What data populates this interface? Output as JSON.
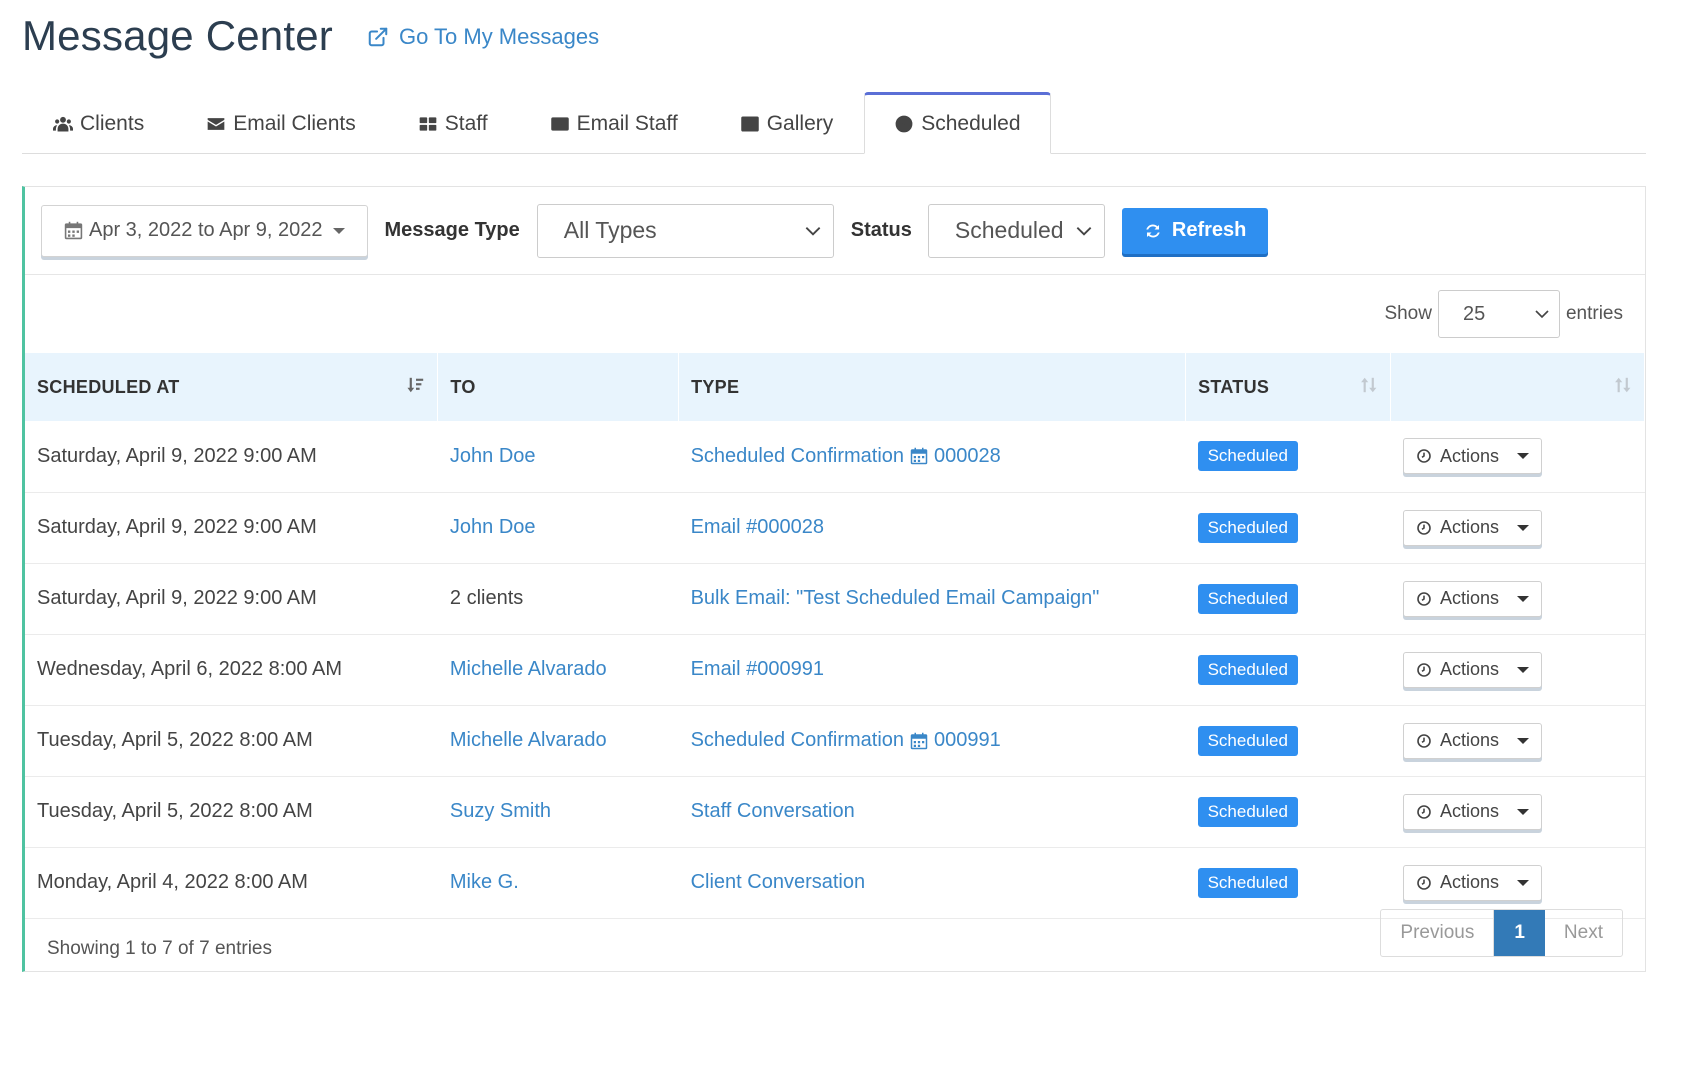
{
  "header": {
    "title": "Message Center",
    "go_link": "Go To My Messages"
  },
  "tabs": [
    {
      "label": "Clients",
      "icon": "users-icon"
    },
    {
      "label": "Email Clients",
      "icon": "envelope-icon"
    },
    {
      "label": "Staff",
      "icon": "grid-icon"
    },
    {
      "label": "Email Staff",
      "icon": "envelope-outline-icon"
    },
    {
      "label": "Gallery",
      "icon": "image-icon"
    },
    {
      "label": "Scheduled",
      "icon": "clock-icon",
      "active": true
    }
  ],
  "filters": {
    "date_range": "Apr 3, 2022 to Apr 9, 2022",
    "message_type_label": "Message Type",
    "message_type_value": "All Types",
    "status_label": "Status",
    "status_value": "Scheduled",
    "refresh_label": "Refresh"
  },
  "show": {
    "prefix": "Show",
    "value": "25",
    "suffix": "entries"
  },
  "table": {
    "columns": [
      "SCHEDULED AT",
      "TO",
      "TYPE",
      "STATUS",
      ""
    ],
    "rows": [
      {
        "scheduled_at": "Saturday, April 9, 2022 9:00 AM",
        "to": "John Doe",
        "to_link": true,
        "type": "Scheduled Confirmation",
        "type_ref": "000028",
        "status": "Scheduled",
        "actions": "Actions"
      },
      {
        "scheduled_at": "Saturday, April 9, 2022 9:00 AM",
        "to": "John Doe",
        "to_link": true,
        "type": "Email  #000028",
        "type_ref": "",
        "status": "Scheduled",
        "actions": "Actions"
      },
      {
        "scheduled_at": "Saturday, April 9, 2022 9:00 AM",
        "to": "2 clients",
        "to_link": false,
        "type": "Bulk Email: \"Test Scheduled Email Campaign\"",
        "type_ref": "",
        "status": "Scheduled",
        "actions": "Actions"
      },
      {
        "scheduled_at": "Wednesday, April 6, 2022 8:00 AM",
        "to": "Michelle Alvarado",
        "to_link": true,
        "type": "Email  #000991",
        "type_ref": "",
        "status": "Scheduled",
        "actions": "Actions"
      },
      {
        "scheduled_at": "Tuesday, April 5, 2022 8:00 AM",
        "to": "Michelle Alvarado",
        "to_link": true,
        "type": "Scheduled Confirmation",
        "type_ref": "000991",
        "status": "Scheduled",
        "actions": "Actions"
      },
      {
        "scheduled_at": "Tuesday, April 5, 2022 8:00 AM",
        "to": "Suzy Smith",
        "to_link": true,
        "type": "Staff Conversation",
        "type_ref": "",
        "status": "Scheduled",
        "actions": "Actions"
      },
      {
        "scheduled_at": "Monday, April 4, 2022 8:00 AM",
        "to": "Mike G.",
        "to_link": true,
        "type": "Client Conversation",
        "type_ref": "",
        "status": "Scheduled",
        "actions": "Actions"
      }
    ]
  },
  "footer": {
    "info": "Showing 1 to 7 of 7 entries",
    "prev": "Previous",
    "current": "1",
    "next": "Next"
  },
  "colors": {
    "accent_blue": "#2f8ff0",
    "link_blue": "#3a87c8",
    "header_row": "#e8f4fd",
    "panel_accent": "#4fc3a1"
  }
}
